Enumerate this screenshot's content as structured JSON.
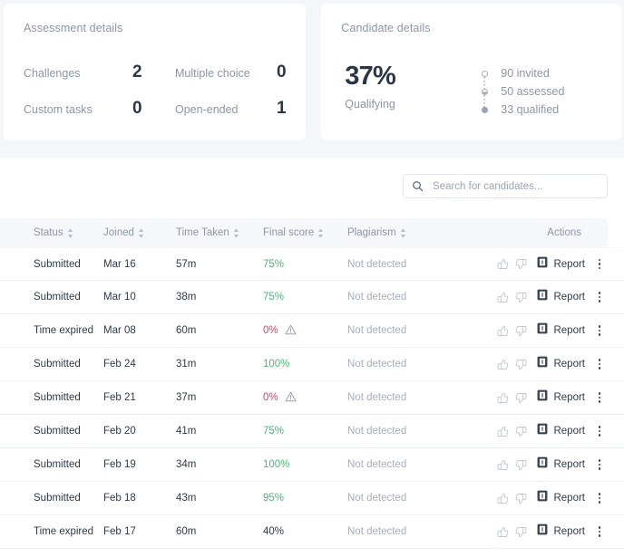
{
  "assessment_card": {
    "title": "Assessment details",
    "stats": [
      {
        "label": "Challenges",
        "value": "2"
      },
      {
        "label": "Multiple choice",
        "value": "0"
      },
      {
        "label": "Custom tasks",
        "value": "0"
      },
      {
        "label": "Open-ended",
        "value": "1"
      }
    ]
  },
  "candidate_card": {
    "title": "Candidate details",
    "percent": "37%",
    "percent_label": "Qualifying",
    "funnel": [
      {
        "label": "90 invited",
        "marker": "hollow"
      },
      {
        "label": "50 assessed",
        "marker": "half"
      },
      {
        "label": "33 qualified",
        "marker": "full"
      }
    ]
  },
  "search": {
    "placeholder": "Search for candidates...",
    "value": "",
    "icon": "search-icon"
  },
  "table": {
    "columns": [
      {
        "key": "status",
        "label": "Status",
        "sortable": true
      },
      {
        "key": "joined",
        "label": "Joined",
        "sortable": true
      },
      {
        "key": "time",
        "label": "Time Taken",
        "sortable": true
      },
      {
        "key": "score",
        "label": "Final score",
        "sortable": true
      },
      {
        "key": "plagiarism",
        "label": "Plagiarism",
        "sortable": true
      },
      {
        "key": "actions",
        "label": "Actions",
        "sortable": false
      }
    ],
    "action_labels": {
      "report": "Report",
      "thumb_up": "thumbs-up-icon",
      "thumb_down": "thumbs-down-icon",
      "report_icon": "report-document-icon",
      "menu": "kebab-menu-icon"
    },
    "rows": [
      {
        "status": "Submitted",
        "joined": "Mar 16",
        "time": "57m",
        "score": "75%",
        "score_state": "green",
        "warning": false,
        "plagiarism": "Not detected"
      },
      {
        "status": "Submitted",
        "joined": "Mar 10",
        "time": "38m",
        "score": "75%",
        "score_state": "green",
        "warning": false,
        "plagiarism": "Not detected"
      },
      {
        "status": "Time expired",
        "joined": "Mar 08",
        "time": "60m",
        "score": "0%",
        "score_state": "red",
        "warning": true,
        "plagiarism": "Not detected"
      },
      {
        "status": "Submitted",
        "joined": "Feb 24",
        "time": "31m",
        "score": "100%",
        "score_state": "green",
        "warning": false,
        "plagiarism": "Not detected"
      },
      {
        "status": "Submitted",
        "joined": "Feb 21",
        "time": "37m",
        "score": "0%",
        "score_state": "red",
        "warning": true,
        "plagiarism": "Not detected"
      },
      {
        "status": "Submitted",
        "joined": "Feb 20",
        "time": "41m",
        "score": "75%",
        "score_state": "green",
        "warning": false,
        "plagiarism": "Not detected"
      },
      {
        "status": "Submitted",
        "joined": "Feb 19",
        "time": "34m",
        "score": "100%",
        "score_state": "green",
        "warning": false,
        "plagiarism": "Not detected"
      },
      {
        "status": "Submitted",
        "joined": "Feb 18",
        "time": "43m",
        "score": "95%",
        "score_state": "green",
        "warning": false,
        "plagiarism": "Not detected"
      },
      {
        "status": "Time expired",
        "joined": "Feb 17",
        "time": "60m",
        "score": "40%",
        "score_state": "dark",
        "warning": false,
        "plagiarism": "Not detected"
      }
    ]
  },
  "colors": {
    "page_bg": "#f4f6fa",
    "card_bg": "#ffffff",
    "text_primary": "#2e3a4a",
    "text_muted": "#8d96a5",
    "score_green": "#49b874",
    "score_red": "#e2386a",
    "header_bg": "#f5f7fa"
  }
}
